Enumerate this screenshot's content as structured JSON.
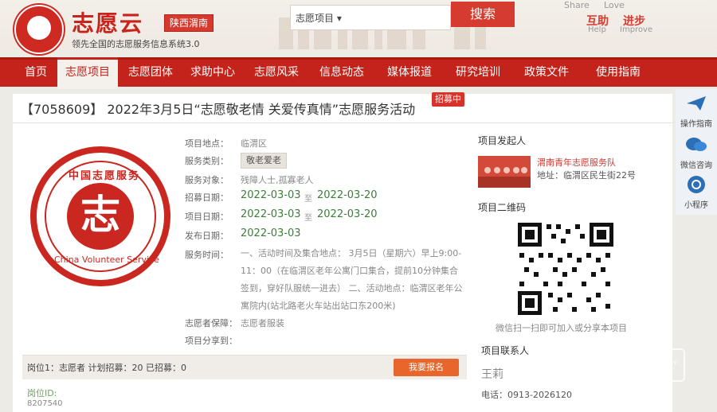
{
  "header": {
    "brand": "志愿云",
    "region": "陕西渭南",
    "slogan": "领先全国的志愿服务信息系统3.0",
    "search_select": "志愿项目",
    "search_button": "搜索",
    "share": "Share",
    "love": "Love",
    "help_cn": "互助",
    "help_en": "Help",
    "improve_cn": "进步",
    "improve_en": "Improve"
  },
  "nav": {
    "items": [
      "首页",
      "志愿项目",
      "志愿团体",
      "求助中心",
      "志愿风采",
      "信息动态",
      "媒体报道",
      "研究培训",
      "政策文件",
      "使用指南"
    ],
    "active_index": 1
  },
  "project": {
    "title": "【7058609】 2022年3月5日“志愿敬老情 关爱传真情”志愿服务活动",
    "status_badge": "招募中",
    "fields": {
      "location_label": "项目地点：",
      "location": "临渭区",
      "category_label": "服务类别：",
      "category": "敬老爱老",
      "target_label": "服务对象：",
      "target": "残障人士,孤寡老人",
      "recruit_label": "招募日期：",
      "recruit_start": "2022-03-03",
      "recruit_end": "2022-03-20",
      "project_date_label": "项目日期：",
      "project_start": "2022-03-03",
      "project_end": "2022-03-20",
      "publish_label": "发布日期：",
      "publish_date": "2022-03-03",
      "to": "至",
      "time_label": "服务时间：",
      "time_text": "一、活动时间及集合地点： 3月5日（星期六）早上9:00-11：00（在临渭区老年公寓门口集合，提前10分钟集合签到，穿好队服统一进去） 二、活动地点：临渭区老年公寓院内(站北路老火车站出站口东200米)",
      "guarantee_label": "志愿者保障：",
      "guarantee": "志愿者服装",
      "share_label": "项目分享到："
    },
    "post": {
      "text": "岗位1：志愿者   计划招募：20   已招募：0",
      "signup_button": "我要报名",
      "id_label": "岗位ID:",
      "id_value": "8207540"
    }
  },
  "logo_text": {
    "top": "中国志愿服务",
    "bottom": "China Volunteer Service",
    "char": "志"
  },
  "sidebar": {
    "initiator_title": "项目发起人",
    "org_name": "渭南青年志愿服务队",
    "org_address": "地址：临渭区民生街22号",
    "qr_title": "项目二维码",
    "qr_caption": "微信扫一扫即可加入或分享本项目",
    "contact_title": "项目联系人",
    "contact_name": "王莉",
    "contact_phone": "电话：0913-2026120"
  },
  "dock": {
    "items": [
      "操作指南",
      "微信咨询",
      "小程序"
    ]
  },
  "watermark": {
    "text": "荣耀渭南",
    "url": "WWW.YEWN.CN",
    "app": "APP"
  },
  "colors": {
    "brand_red": "#c4231b",
    "date_green": "#3c7d3a",
    "signup_orange": "#e8662b"
  }
}
